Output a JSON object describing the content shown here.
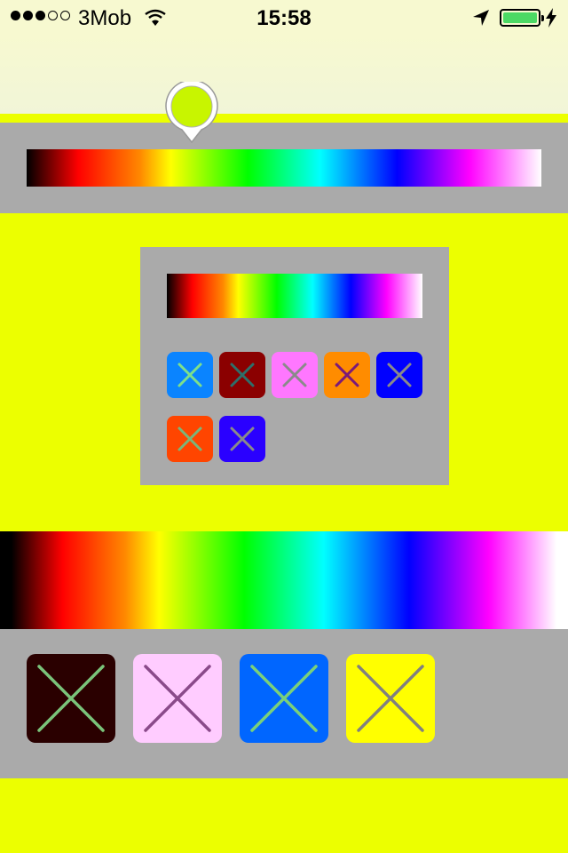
{
  "status_bar": {
    "signal_bars_filled": 3,
    "signal_bars_total": 5,
    "carrier": "3Mob",
    "time": "15:58",
    "battery_level": 1.0,
    "charging": true,
    "icons": [
      "wifi-icon",
      "location-arrow-icon",
      "battery-icon",
      "charging-bolt-icon"
    ]
  },
  "colors": {
    "background": "#ecff00",
    "panel": "#aaaaaa",
    "selected_color": "#c8f500"
  },
  "small_swatches": [
    {
      "bg": "#0a84ff",
      "mark": "#7ee08a"
    },
    {
      "bg": "#8b0000",
      "mark": "#2e6f6a"
    },
    {
      "bg": "#ff77ff",
      "mark": "#8a8a8a"
    },
    {
      "bg": "#ff8c00",
      "mark": "#7a1a7a"
    },
    {
      "bg": "#0000ff",
      "mark": "#8a8a8a"
    },
    {
      "bg": "#ff4500",
      "mark": "#7ab67a"
    },
    {
      "bg": "#2a00ff",
      "mark": "#8a8a8a"
    }
  ],
  "large_swatches": [
    {
      "bg": "#2a0000",
      "mark": "#7ac47a"
    },
    {
      "bg": "#ffccff",
      "mark": "#8a4a8a"
    },
    {
      "bg": "#0066ff",
      "mark": "#7ad07a"
    },
    {
      "bg": "#ffff00",
      "mark": "#808080"
    }
  ]
}
